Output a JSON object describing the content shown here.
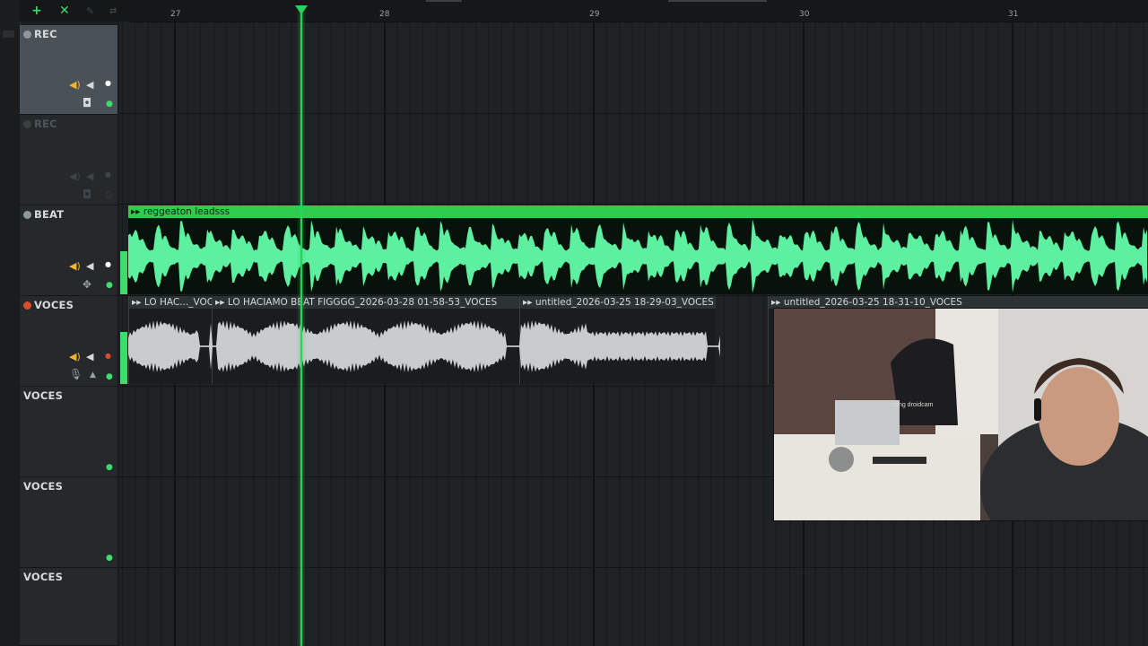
{
  "toolbar": {
    "add_icon": "plus-icon",
    "close_icon": "close-icon",
    "pencil_icon": "pencil-icon",
    "arrows_icon": "arrows-icon"
  },
  "ruler": {
    "bars": [
      "27",
      "28",
      "29",
      "30",
      "31"
    ]
  },
  "tracks": [
    {
      "name": "REC",
      "state": "active"
    },
    {
      "name": "REC",
      "state": "disabled"
    },
    {
      "name": "BEAT",
      "state": "normal"
    },
    {
      "name": "VOCES",
      "state": "armed"
    },
    {
      "name": "VOCES",
      "state": "normal"
    },
    {
      "name": "VOCES",
      "state": "normal"
    },
    {
      "name": "VOCES",
      "state": "normal"
    }
  ],
  "clips": {
    "beat": {
      "title": "reggeaton leadsss"
    },
    "voces": [
      {
        "title": "LO HAC..._VOCES"
      },
      {
        "title": "LO HACIAMO BEAT FIGGGG_2026-03-28 01-58-53_VOCES"
      },
      {
        "title": "untitled_2026-03-25 18-29-03_VOCES"
      },
      {
        "title": "untitled_2026-03-25 18-31-10_VOCES"
      }
    ]
  },
  "webcam": {
    "overlay_text": "using droidcam"
  },
  "colors": {
    "accent_green": "#2ecc4f",
    "waveform_green": "#5cf0a0",
    "waveform_gray": "#c8cccf",
    "record_red": "#d94a2f",
    "speaker_yellow": "#f0b429"
  }
}
